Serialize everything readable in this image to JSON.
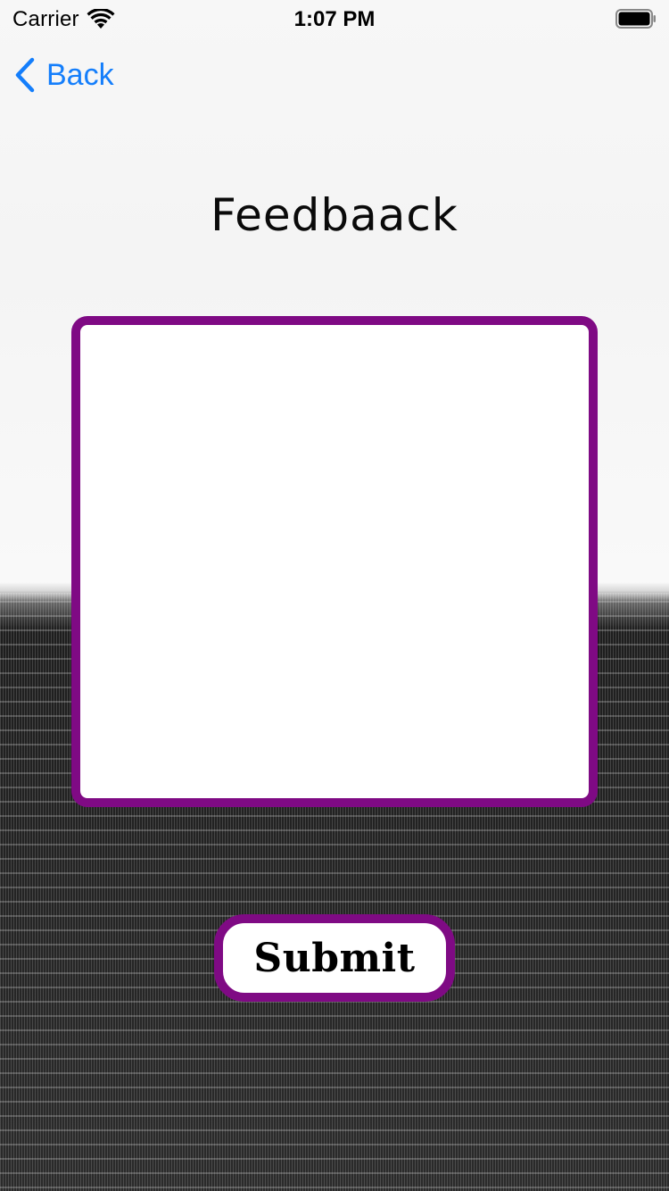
{
  "status_bar": {
    "carrier": "Carrier",
    "time": "1:07 PM",
    "icons": [
      "wifi-icon",
      "battery-icon"
    ]
  },
  "nav": {
    "back_label": "Back",
    "back_icon": "chevron-left-icon"
  },
  "page": {
    "title": "Feedbaack"
  },
  "feedback": {
    "value": "",
    "placeholder": ""
  },
  "actions": {
    "submit_label": "Submit"
  },
  "colors": {
    "accent_purple": "#7f0a84",
    "link_blue": "#147efb"
  }
}
